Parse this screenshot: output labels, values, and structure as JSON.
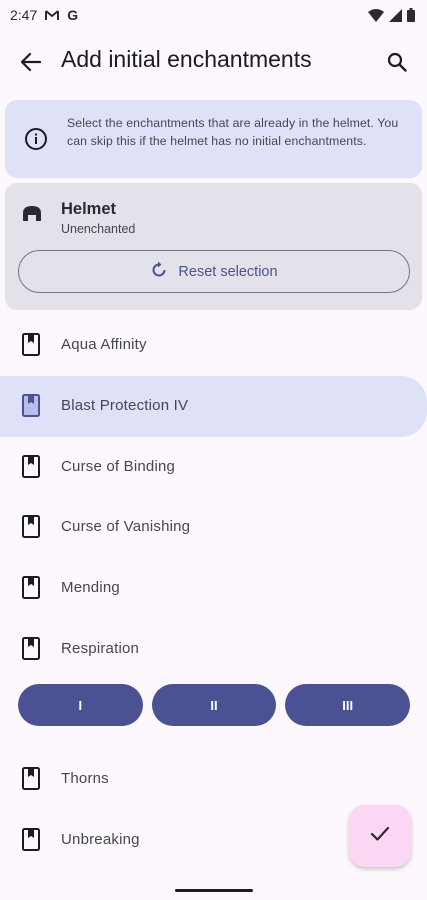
{
  "status_bar": {
    "time": "2:47",
    "notification_icons": [
      "gmail-icon",
      "google-icon"
    ],
    "system_icons": [
      "wifi-icon",
      "cell-signal-icon",
      "battery-icon"
    ]
  },
  "app_bar": {
    "title": "Add initial enchantments",
    "back_icon": "arrow-back-icon",
    "search_icon": "search-icon"
  },
  "info": {
    "icon": "info-icon",
    "text": "Select the enchantments that are already in the helmet. You can skip this if the helmet has no initial enchantments."
  },
  "item": {
    "icon": "helmet-icon",
    "name": "Helmet",
    "status": "Unenchanted",
    "reset_label": "Reset selection",
    "reset_icon": "refresh-icon"
  },
  "enchantments": [
    {
      "label": "Aqua Affinity",
      "selected": false
    },
    {
      "label": "Blast Protection IV",
      "selected": true
    },
    {
      "label": "Curse of Binding",
      "selected": false
    },
    {
      "label": "Curse of Vanishing",
      "selected": false
    },
    {
      "label": "Mending",
      "selected": false
    },
    {
      "label": "Respiration",
      "selected": false
    },
    {
      "label": "Thorns",
      "selected": false
    },
    {
      "label": "Unbreaking",
      "selected": false
    }
  ],
  "levels": [
    "I",
    "II",
    "III"
  ],
  "colors": {
    "background": "#fcf8fd",
    "info_card": "#dfe1f9",
    "item_card": "#e3e2ea",
    "primary": "#4a5294",
    "fab": "#fbd7f4"
  },
  "fab": {
    "icon": "check-icon"
  }
}
